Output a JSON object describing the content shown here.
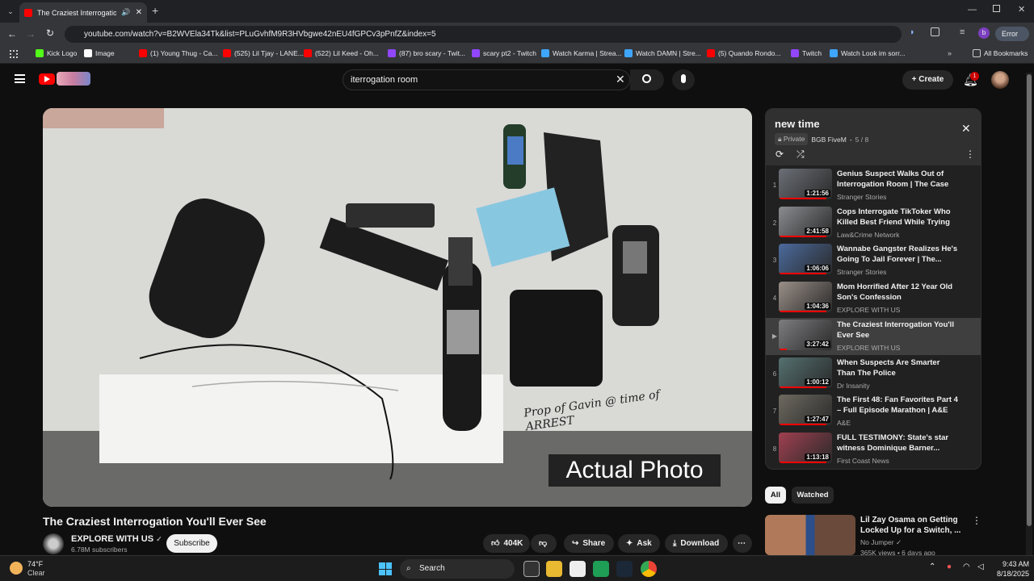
{
  "browser": {
    "tab_title": "The Craziest Interrogation V",
    "url": "youtube.com/watch?v=B2WVEla34Tk&list=PLuGvhfM9R3HVbgwe42nEU4fGPCv3pPnfZ&index=5",
    "profile_initial": "b",
    "error_label": "Error",
    "bookmarks": [
      {
        "label": "Kick Logo",
        "color": "#53fc18"
      },
      {
        "label": "Image",
        "color": "#ffffff"
      },
      {
        "label": "(1) Young Thug - Ca...",
        "color": "#ff0000"
      },
      {
        "label": "(525) Lil Tjay - LANE...",
        "color": "#ff0000"
      },
      {
        "label": "(522) Lil Keed - Oh...",
        "color": "#ff0000"
      },
      {
        "label": "(87) bro scary - Twit...",
        "color": "#9146ff"
      },
      {
        "label": "scary pt2 - Twitch",
        "color": "#9146ff"
      },
      {
        "label": "Watch Karma | Strea...",
        "color": "#3ea6ff"
      },
      {
        "label": "Watch DAMN | Stre...",
        "color": "#3ea6ff"
      },
      {
        "label": "(5) Quando Rondo...",
        "color": "#ff0000"
      },
      {
        "label": "Twitch",
        "color": "#9146ff"
      },
      {
        "label": "Watch Look im sorr...",
        "color": "#3ea6ff"
      }
    ],
    "all_bookmarks": "All Bookmarks"
  },
  "header": {
    "search_value": "iterrogation room",
    "create_label": "Create",
    "notification_count": "1"
  },
  "video": {
    "overlay_handwriting": "Prop of Gavin @ time of ARREST",
    "overlay_caption": "Actual Photo",
    "title": "The Craziest Interrogation You'll Ever See",
    "channel": "EXPLORE WITH US",
    "subscribers": "6.78M subscribers",
    "subscribe_label": "Subscribe",
    "likes": "404K",
    "share_label": "Share",
    "ask_label": "Ask",
    "download_label": "Download"
  },
  "playlist": {
    "title": "new time",
    "privacy": "Private",
    "owner": "BGB FiveM",
    "position": "5 / 8",
    "items": [
      {
        "num": "1",
        "title": "Genius Suspect Walks Out of Interrogation Room | The Case o...",
        "channel": "Stranger Stories",
        "duration": "1:21:56",
        "progress": 0.9,
        "thumb": "#6b6f76"
      },
      {
        "num": "2",
        "title": "Cops Interrogate TikToker Who Killed Best Friend While Trying t...",
        "channel": "Law&Crime Network",
        "duration": "2:41:58",
        "progress": 0.9,
        "thumb": "#8a8c90"
      },
      {
        "num": "3",
        "title": "Wannabe Gangster Realizes He's Going To Jail Forever | The...",
        "channel": "Stranger Stories",
        "duration": "1:06:06",
        "progress": 0.9,
        "thumb": "#4b6a9c"
      },
      {
        "num": "4",
        "title": "Mom Horrified After 12 Year Old Son's Confession",
        "channel": "EXPLORE WITH US",
        "duration": "1:04:36",
        "progress": 0.9,
        "thumb": "#9a8f88"
      },
      {
        "num": "▶",
        "title": "The Craziest Interrogation You'll Ever See",
        "channel": "EXPLORE WITH US",
        "duration": "3:27:42",
        "progress": 0.15,
        "thumb": "#7d7d80",
        "active": true
      },
      {
        "num": "6",
        "title": "When Suspects Are Smarter Than The Police",
        "channel": "Dr Insanity",
        "duration": "1:00:12",
        "progress": 0.9,
        "thumb": "#557070"
      },
      {
        "num": "7",
        "title": "The First 48: Fan Favorites Part 4 – Full Episode Marathon | A&E",
        "channel": "A&E",
        "duration": "1:27:47",
        "progress": 0.9,
        "thumb": "#6e6a60"
      },
      {
        "num": "8",
        "title": "FULL TESTIMONY: State's star witness Dominique Barner...",
        "channel": "First Coast News",
        "duration": "1:13:18",
        "progress": 0.9,
        "thumb": "#a04050"
      }
    ]
  },
  "chips": [
    "All",
    "Watched"
  ],
  "recommendation": {
    "title": "Lil Zay Osama on Getting Locked Up for a Switch, ...",
    "channel": "No Jumper",
    "meta": "365K views • 6 days ago"
  },
  "taskbar": {
    "weather_temp": "74°F",
    "weather_desc": "Clear",
    "search_label": "Search",
    "time": "9:43 AM",
    "date": "8/18/2025"
  }
}
